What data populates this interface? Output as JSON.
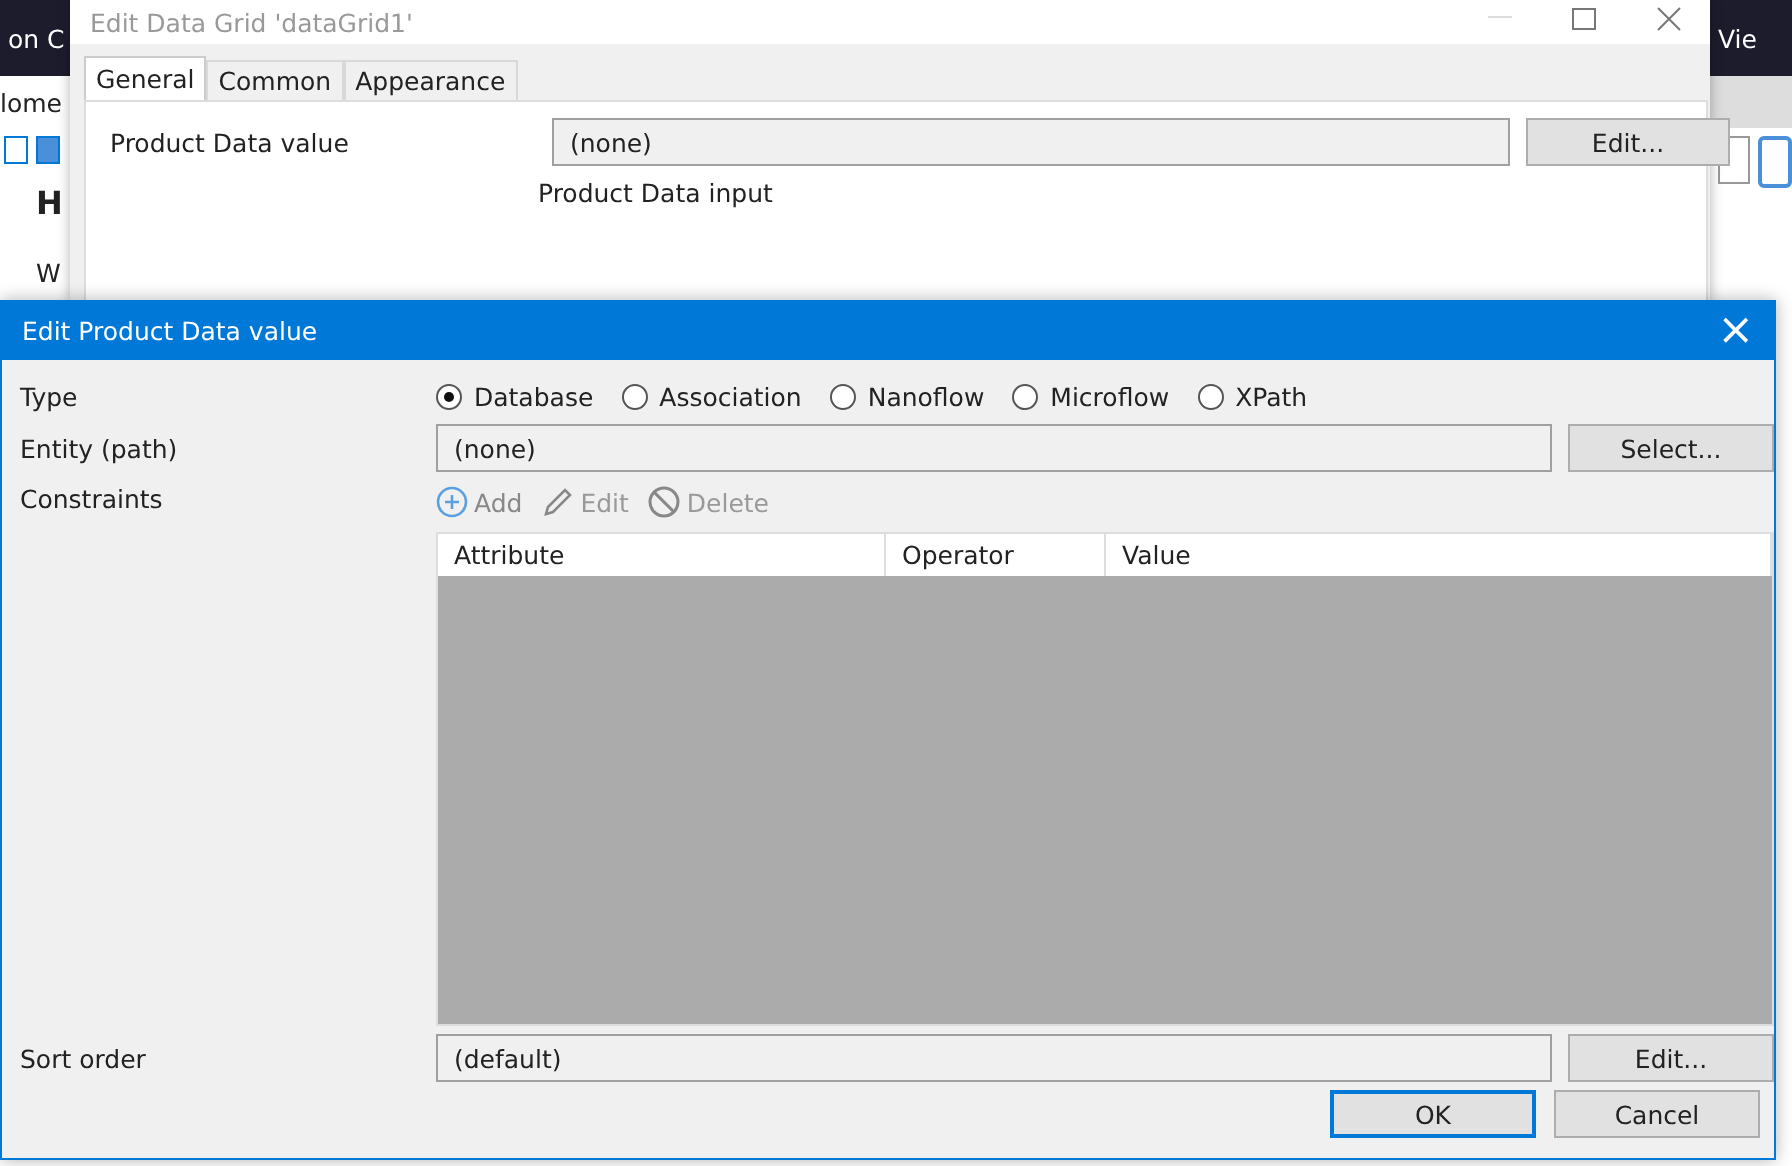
{
  "background_app": {
    "left_texts": [
      "on C",
      "lome",
      "H",
      "W"
    ],
    "right_text": "Vie"
  },
  "back_dialog": {
    "title": "Edit Data Grid 'dataGrid1'",
    "tabs": [
      {
        "label": "General",
        "selected": true
      },
      {
        "label": "Common",
        "selected": false
      },
      {
        "label": "Appearance",
        "selected": false
      }
    ],
    "field_label": "Product Data value",
    "field_value": "(none)",
    "edit_button": "Edit...",
    "hint": "Product Data input"
  },
  "dialog": {
    "title": "Edit Product Data value",
    "close": "×",
    "type_label": "Type",
    "type_options": [
      {
        "label": "Database",
        "selected": true
      },
      {
        "label": "Association",
        "selected": false
      },
      {
        "label": "Nanoflow",
        "selected": false
      },
      {
        "label": "Microflow",
        "selected": false
      },
      {
        "label": "XPath",
        "selected": false
      }
    ],
    "entity_label": "Entity (path)",
    "entity_value": "(none)",
    "select_button": "Select...",
    "constraints_label": "Constraints",
    "toolbar": [
      {
        "kind": "add",
        "label": "Add",
        "disabled": false
      },
      {
        "kind": "edit",
        "label": "Edit",
        "disabled": true
      },
      {
        "kind": "delete",
        "label": "Delete",
        "disabled": true
      }
    ],
    "columns": [
      "Attribute",
      "Operator",
      "Value"
    ],
    "sort_label": "Sort order",
    "sort_value": "(default)",
    "sort_button": "Edit...",
    "buttons": [
      {
        "label": "OK",
        "default": true
      },
      {
        "label": "Cancel",
        "default": false
      }
    ]
  }
}
